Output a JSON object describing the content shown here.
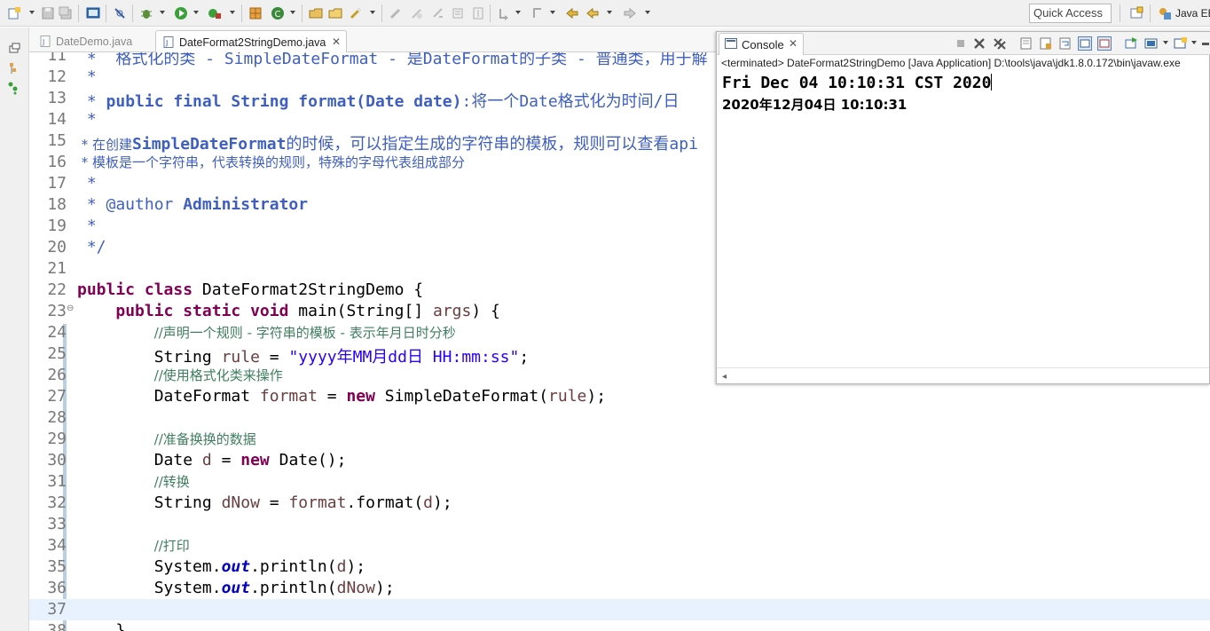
{
  "toolbar": {
    "quick_access_placeholder": "Quick Access",
    "perspective_label": "Java EE"
  },
  "editor": {
    "tabs": [
      {
        "label": "DateDemo.java",
        "active": false
      },
      {
        "label": "DateFormat2StringDemo.java",
        "active": true
      }
    ],
    "lines": [
      {
        "n": "11",
        "segs": [
          {
            "c": "jd",
            "t": " *  格式化的类 - SimpleDateFormat - 是DateFormat的子类 - 普通类，用于解"
          }
        ]
      },
      {
        "n": "12",
        "segs": [
          {
            "c": "jd",
            "t": " *"
          }
        ]
      },
      {
        "n": "13",
        "segs": [
          {
            "c": "jd",
            "t": " * "
          },
          {
            "c": "jdb",
            "t": "public final String format(Date date)"
          },
          {
            "c": "jd",
            "t": ":将一个Date格式化为时间/日"
          }
        ]
      },
      {
        "n": "14",
        "segs": [
          {
            "c": "jd",
            "t": " *"
          }
        ]
      },
      {
        "n": "15",
        "segs": [
          {
            "c": "jd",
            "t": " * 在创建"
          },
          {
            "c": "jdb",
            "t": "SimpleDateFormat"
          },
          {
            "c": "jd",
            "t": "的时候，可以指定生成的字符串的模板，规则可以查看api"
          }
        ]
      },
      {
        "n": "16",
        "segs": [
          {
            "c": "jd",
            "t": " * 模板是一个字符串，代表转换的规则，特殊的字母代表组成部分"
          }
        ]
      },
      {
        "n": "17",
        "segs": [
          {
            "c": "jd",
            "t": " *"
          }
        ]
      },
      {
        "n": "18",
        "segs": [
          {
            "c": "jd",
            "t": " * @author "
          },
          {
            "c": "jdb",
            "t": "Administrator"
          }
        ]
      },
      {
        "n": "19",
        "segs": [
          {
            "c": "jd",
            "t": " *"
          }
        ]
      },
      {
        "n": "20",
        "segs": [
          {
            "c": "jd",
            "t": " */"
          }
        ]
      },
      {
        "n": "21",
        "segs": []
      },
      {
        "n": "22",
        "segs": [
          {
            "c": "kw",
            "t": "public class"
          },
          {
            "c": "",
            "t": " DateFormat2StringDemo {"
          }
        ]
      },
      {
        "n": "23",
        "fold": "⊖",
        "segs": [
          {
            "c": "",
            "t": "    "
          },
          {
            "c": "kw",
            "t": "public static void"
          },
          {
            "c": "",
            "t": " main(String[] "
          },
          {
            "c": "var",
            "t": "args"
          },
          {
            "c": "",
            "t": ") {"
          }
        ]
      },
      {
        "n": "24",
        "segs": [
          {
            "c": "",
            "t": "        "
          },
          {
            "c": "cm",
            "t": "//声明一个规则 - 字符串的模板 - 表示年月日时分秒"
          }
        ]
      },
      {
        "n": "25",
        "segs": [
          {
            "c": "",
            "t": "        String "
          },
          {
            "c": "var",
            "t": "rule"
          },
          {
            "c": "",
            "t": " = "
          },
          {
            "c": "str",
            "t": "\"yyyy年MM月dd日 HH:mm:ss\""
          },
          {
            "c": "",
            "t": ";"
          }
        ]
      },
      {
        "n": "26",
        "segs": [
          {
            "c": "",
            "t": "        "
          },
          {
            "c": "cm",
            "t": "//使用格式化类来操作"
          }
        ]
      },
      {
        "n": "27",
        "segs": [
          {
            "c": "",
            "t": "        DateFormat "
          },
          {
            "c": "var",
            "t": "format"
          },
          {
            "c": "",
            "t": " = "
          },
          {
            "c": "kw",
            "t": "new"
          },
          {
            "c": "",
            "t": " SimpleDateFormat("
          },
          {
            "c": "var",
            "t": "rule"
          },
          {
            "c": "",
            "t": ");"
          }
        ]
      },
      {
        "n": "28",
        "segs": []
      },
      {
        "n": "29",
        "segs": [
          {
            "c": "",
            "t": "        "
          },
          {
            "c": "cm",
            "t": "//准备换换的数据"
          }
        ]
      },
      {
        "n": "30",
        "segs": [
          {
            "c": "",
            "t": "        Date "
          },
          {
            "c": "var",
            "t": "d"
          },
          {
            "c": "",
            "t": " = "
          },
          {
            "c": "kw",
            "t": "new"
          },
          {
            "c": "",
            "t": " Date();"
          }
        ]
      },
      {
        "n": "31",
        "segs": [
          {
            "c": "",
            "t": "        "
          },
          {
            "c": "cm",
            "t": "//转换"
          }
        ]
      },
      {
        "n": "32",
        "segs": [
          {
            "c": "",
            "t": "        String "
          },
          {
            "c": "var",
            "t": "dNow"
          },
          {
            "c": "",
            "t": " = "
          },
          {
            "c": "var",
            "t": "format"
          },
          {
            "c": "",
            "t": ".format("
          },
          {
            "c": "var",
            "t": "d"
          },
          {
            "c": "",
            "t": ");"
          }
        ]
      },
      {
        "n": "33",
        "segs": []
      },
      {
        "n": "34",
        "segs": [
          {
            "c": "",
            "t": "        "
          },
          {
            "c": "cm",
            "t": "//打印"
          }
        ]
      },
      {
        "n": "35",
        "segs": [
          {
            "c": "",
            "t": "        System."
          },
          {
            "c": "fld",
            "t": "out"
          },
          {
            "c": "",
            "t": ".println("
          },
          {
            "c": "var",
            "t": "d"
          },
          {
            "c": "",
            "t": ");"
          }
        ]
      },
      {
        "n": "36",
        "segs": [
          {
            "c": "",
            "t": "        System."
          },
          {
            "c": "fld",
            "t": "out"
          },
          {
            "c": "",
            "t": ".println("
          },
          {
            "c": "var",
            "t": "dNow"
          },
          {
            "c": "",
            "t": ");"
          }
        ]
      },
      {
        "n": "37",
        "current": true,
        "segs": []
      },
      {
        "n": "38",
        "segs": [
          {
            "c": "",
            "t": "    }"
          }
        ]
      }
    ]
  },
  "console": {
    "tab_label": "Console",
    "status": "<terminated> DateFormat2StringDemo [Java Application] D:\\tools\\java\\jdk1.8.0.172\\bin\\javaw.exe",
    "output_lines": [
      "Fri Dec 04 10:10:31 CST 2020",
      "2020年12月04日 10:10:31"
    ]
  },
  "colors": {
    "keyword": "#7f0055",
    "string": "#2a00ff",
    "comment": "#3f7f5f",
    "javadoc": "#3f5fbf",
    "variable": "#6a3e3e",
    "static_field": "#0000c0",
    "current_line": "#e8f2fe"
  }
}
